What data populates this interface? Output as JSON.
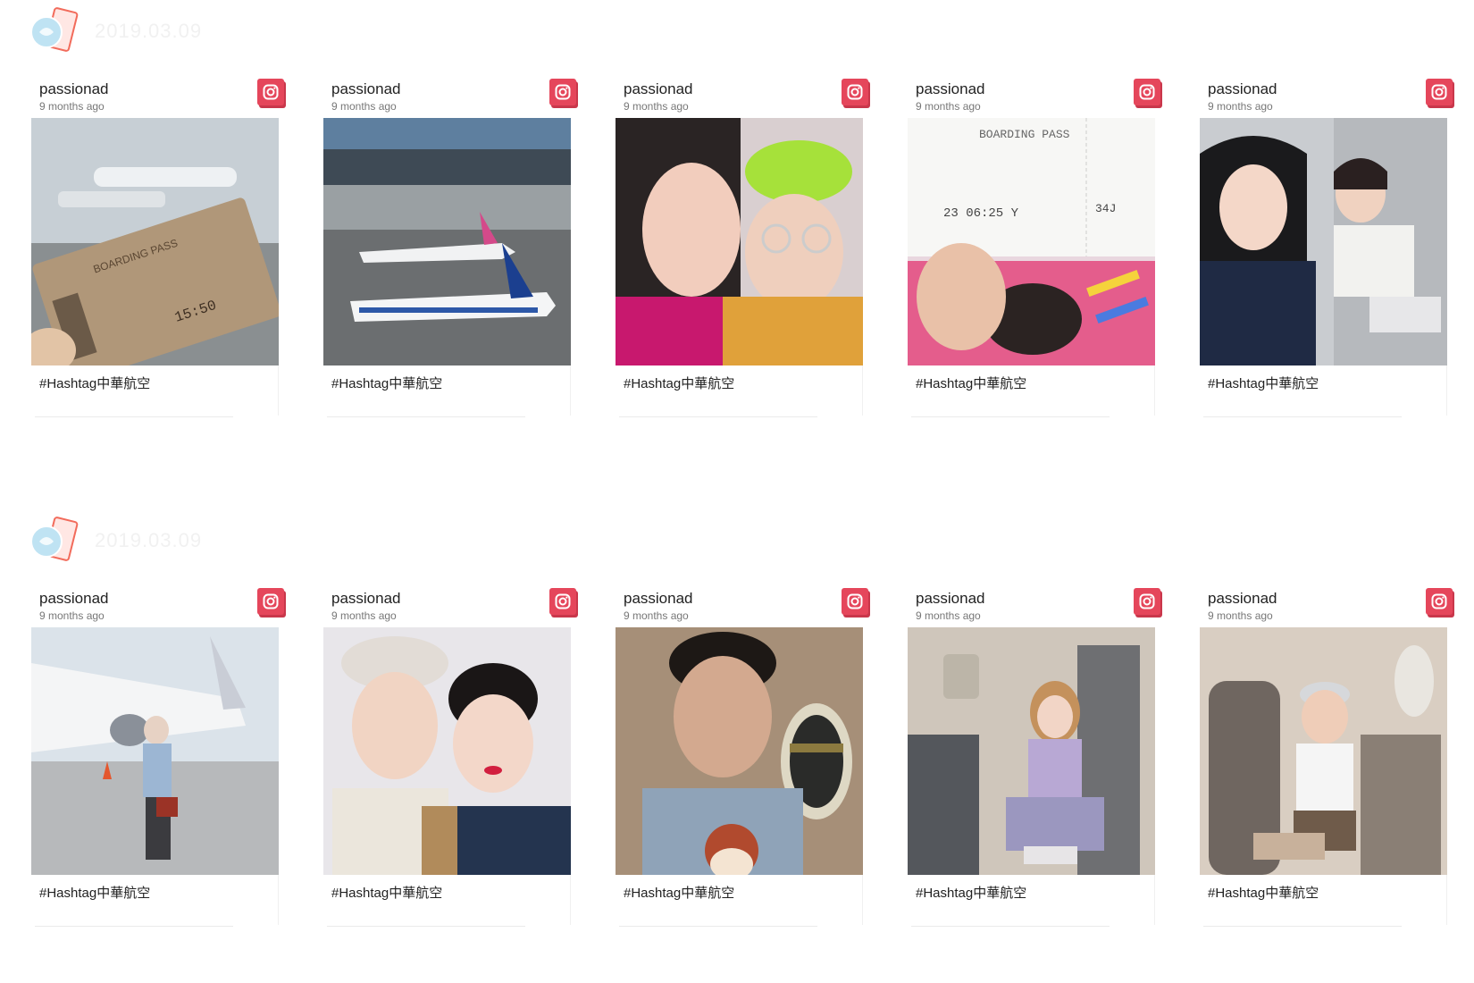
{
  "sections": [
    {
      "date": "2019.03.09",
      "posts": [
        {
          "user": "passionad",
          "time": "9 months ago",
          "caption": "#Hashtag中華航空",
          "photo": "boarding-pass-window"
        },
        {
          "user": "passionad",
          "time": "9 months ago",
          "caption": "#Hashtag中華航空",
          "photo": "planes-on-runway"
        },
        {
          "user": "passionad",
          "time": "9 months ago",
          "caption": "#Hashtag中華航空",
          "photo": "selfie-two-women"
        },
        {
          "user": "passionad",
          "time": "9 months ago",
          "caption": "#Hashtag中華航空",
          "photo": "boarding-pass-hand"
        },
        {
          "user": "passionad",
          "time": "9 months ago",
          "caption": "#Hashtag中華航空",
          "photo": "cabin-selfie"
        }
      ]
    },
    {
      "date": "2019.03.09",
      "posts": [
        {
          "user": "passionad",
          "time": "9 months ago",
          "caption": "#Hashtag中華航空",
          "photo": "woman-by-airplane"
        },
        {
          "user": "passionad",
          "time": "9 months ago",
          "caption": "#Hashtag中華航空",
          "photo": "selfie-with-crew"
        },
        {
          "user": "passionad",
          "time": "9 months ago",
          "caption": "#Hashtag中華航空",
          "photo": "man-window-selfie"
        },
        {
          "user": "passionad",
          "time": "9 months ago",
          "caption": "#Hashtag中華航空",
          "photo": "woman-business-seat"
        },
        {
          "user": "passionad",
          "time": "9 months ago",
          "caption": "#Hashtag中華航空",
          "photo": "man-business-seat"
        }
      ]
    }
  ],
  "icons": {
    "source": "instagram-icon"
  },
  "colors": {
    "instagram_badge": "#e5465b",
    "text": "#222222",
    "muted": "#777777"
  }
}
